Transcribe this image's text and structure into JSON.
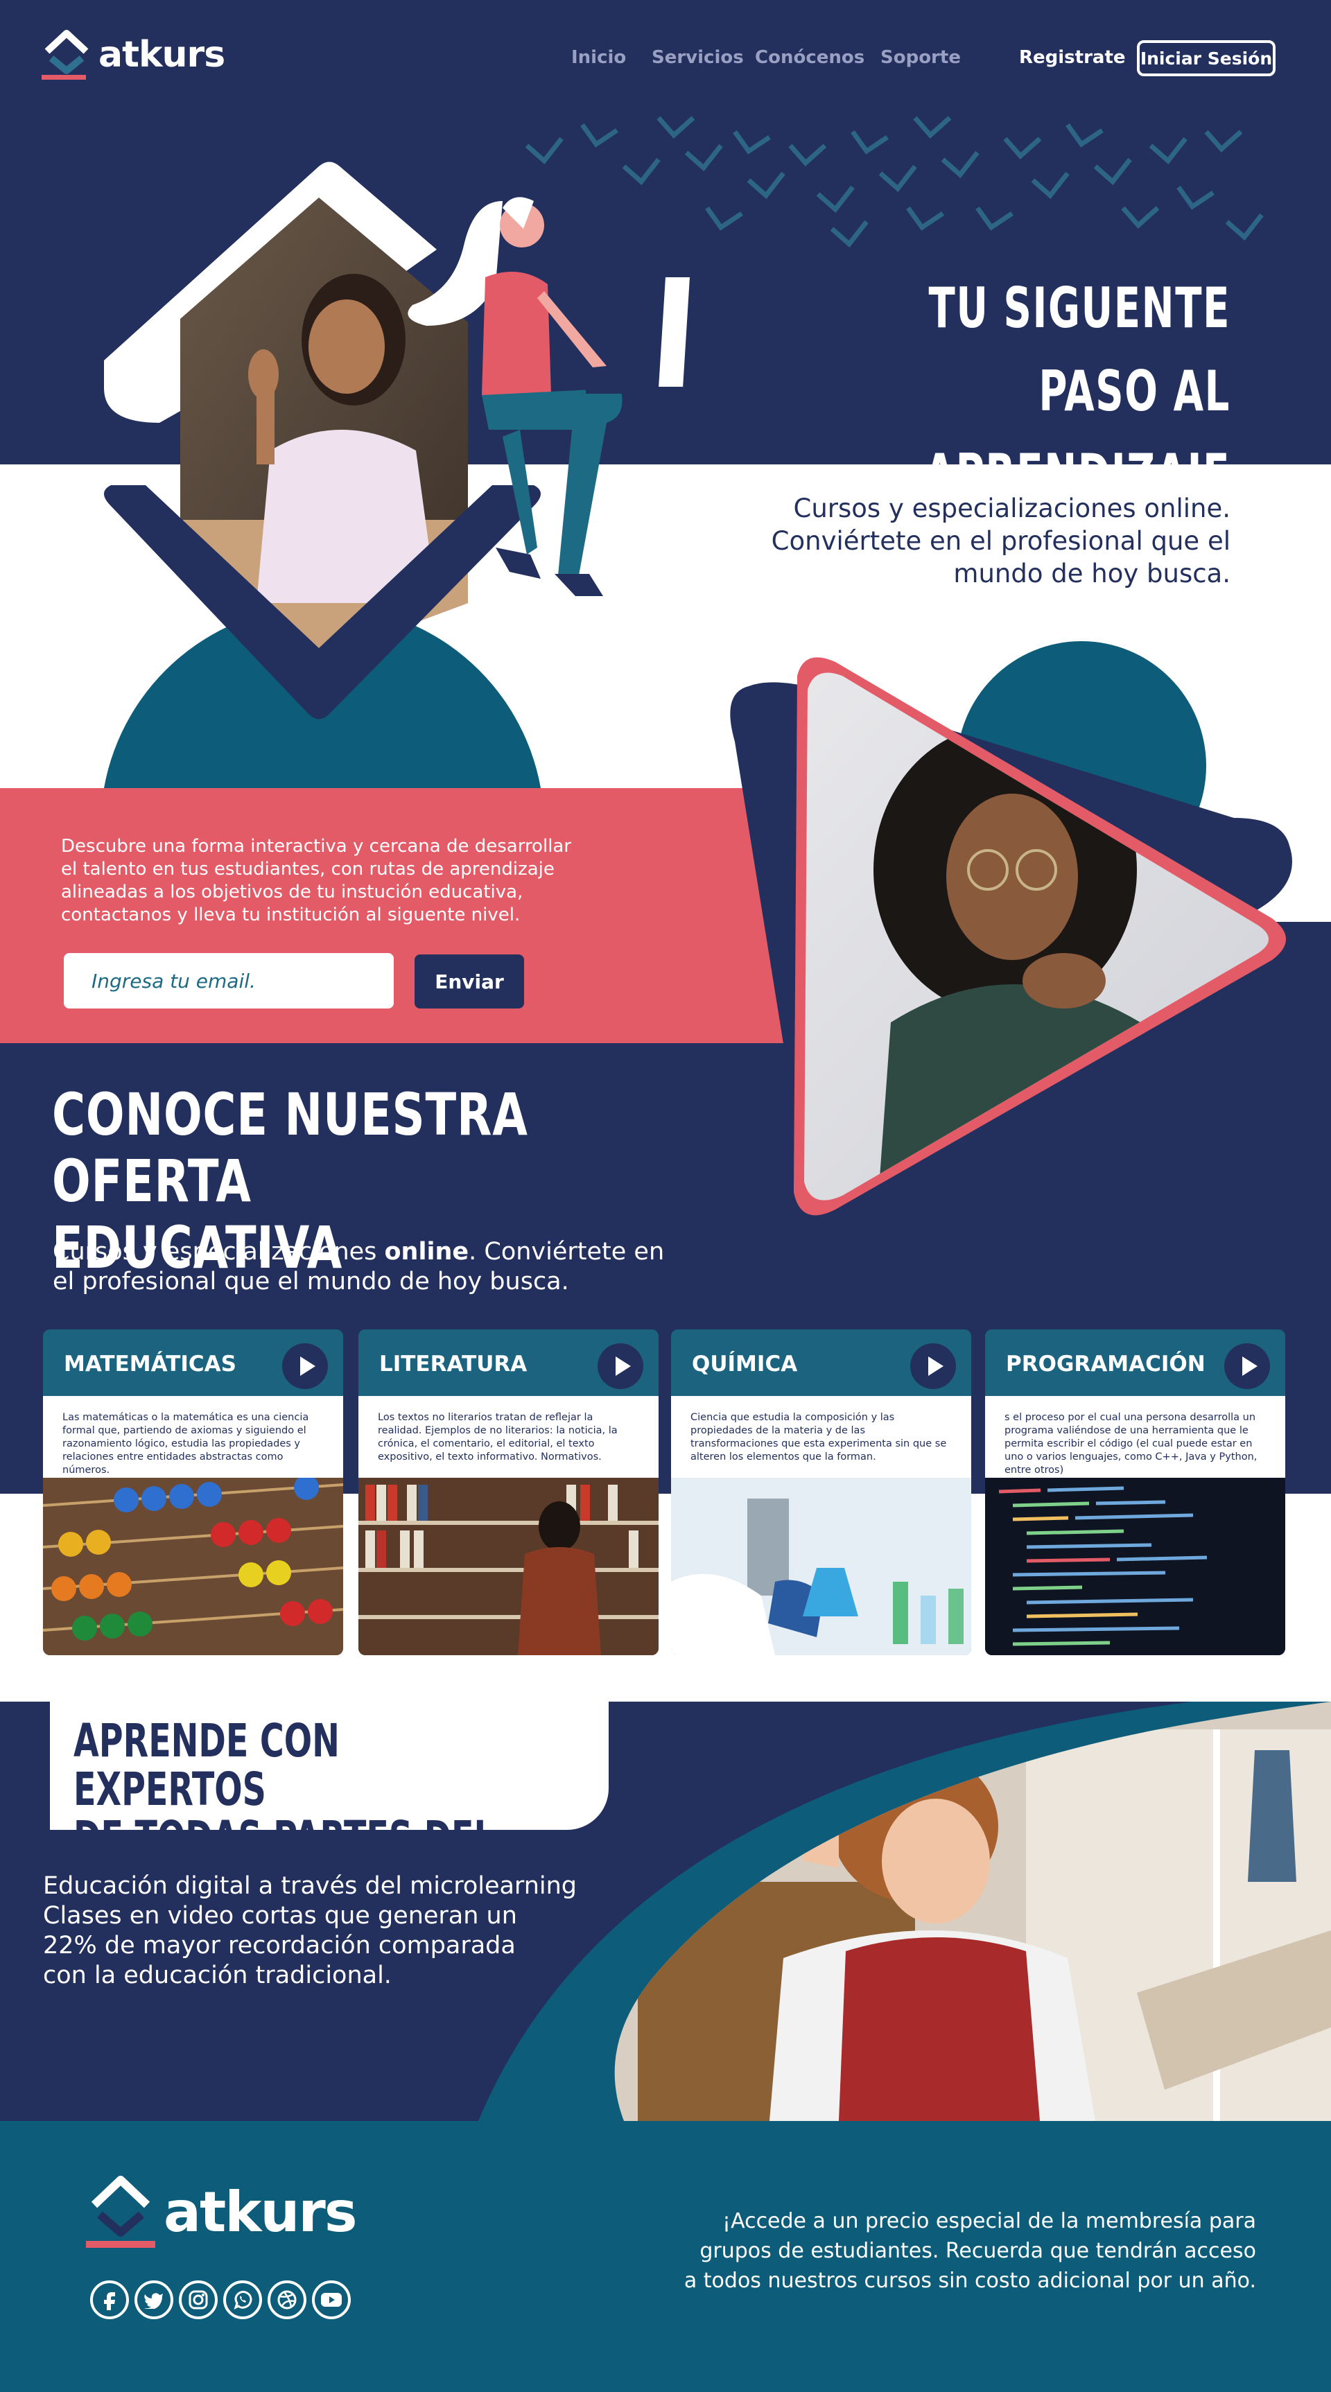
{
  "colors": {
    "navy": "#23305e",
    "teal": "#0d5c7a",
    "coral": "#e45b68",
    "white": "#ffffff"
  },
  "nav": {
    "brand": "atkurs",
    "links": [
      "Inicio",
      "Servicios",
      "Conócenos",
      "Soporte"
    ],
    "register": "Registrate",
    "login": "Iniciar Sesión"
  },
  "hero": {
    "title_line1": "TU SIGUENTE PASO AL",
    "title_line2": "APRENDIZAJE",
    "subtitle_line1": "Cursos y especializaciones online.",
    "subtitle_line2": "Conviértete en el profesional que el",
    "subtitle_line3": "mundo de hoy busca."
  },
  "promo": {
    "text_line1": "Descubre una forma interactiva y cercana de desarrollar",
    "text_line2": "el talento en tus estudiantes, con rutas de aprendizaje",
    "text_line3": "alineadas a los objetivos de tu instución educativa,",
    "text_line4": "contactanos y lleva tu institución al siguente nivel.",
    "email_placeholder": "Ingresa tu email.",
    "send": "Enviar"
  },
  "oferta": {
    "title_line1": "CONOCE NUESTRA OFERTA",
    "title_line2": "EDUCATIVA",
    "sub_before": "Cursos y especializaciones ",
    "sub_bold": "online",
    "sub_after": ". Conviértete en",
    "sub_line2": "el profesional que el mundo de hoy busca."
  },
  "cards": [
    {
      "title": "MATEMÁTICAS",
      "desc": "Las matemáticas o la matemática es una ciencia formal que, partiendo de axiomas y siguiendo el razonamiento lógico, estudia las propiedades y relaciones entre entidades abstractas como números."
    },
    {
      "title": "LITERATURA",
      "desc": "Los textos no literarios tratan de reflejar la realidad. Ejemplos de no literarios: la noticia, la crónica, el comentario, el editorial, el texto expositivo, el texto informativo. Normativos."
    },
    {
      "title": "QUÍMICA",
      "desc": "Ciencia que estudia la composición y las propiedades de la materia y de las transformaciones que esta experimenta sin que se alteren los elementos que la forman."
    },
    {
      "title": "PROGRAMACIÓN",
      "desc": "s el proceso por el cual una persona desarrolla un programa valiéndose de una herramienta que le permita escribir el código (el cual puede estar en uno o varios lenguajes, como C++, Java y Python, entre otros)"
    }
  ],
  "expertos": {
    "title_line1": "APRENDE CON EXPERTOS",
    "title_line2": "DE TODAS PARTES DEL MUNDO",
    "text_line1": "Educación digital a través del microlearning",
    "text_line2": "Clases en video cortas que generan un",
    "text_line3": "22% de mayor recordación comparada",
    "text_line4": "con la educación tradicional."
  },
  "footer": {
    "brand": "atkurs",
    "social_icons": [
      "facebook-icon",
      "twitter-icon",
      "instagram-icon",
      "whatsapp-icon",
      "dribbble-icon",
      "youtube-icon"
    ],
    "text_line1": "¡Accede a un precio especial de la membresía para",
    "text_line2": "grupos de estudiantes. Recuerda que  tendrán acceso",
    "text_line3": "a todos nuestros cursos sin costo adicional por un año."
  }
}
